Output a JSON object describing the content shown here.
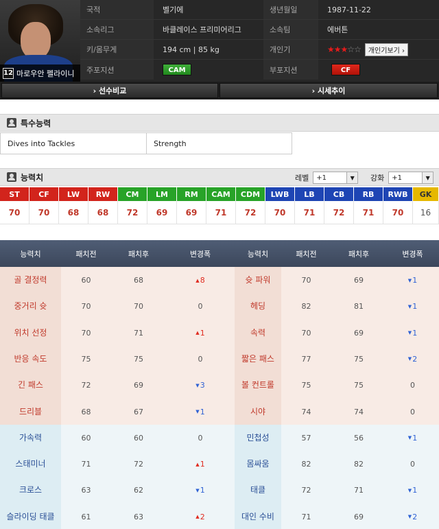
{
  "profile": {
    "number": "12",
    "name": "마로우안 펠라이니",
    "rows": [
      {
        "l1": "국적",
        "v1": "벨기에",
        "l2": "생년월일",
        "v2": "1987-11-22"
      },
      {
        "l1": "소속리그",
        "v1": "바클레이스 프리미어리그",
        "l2": "소속팀",
        "v2": "에버튼"
      },
      {
        "l1": "키/몸무게",
        "v1": "194 cm | 85 kg",
        "l2": "개인기",
        "v2": ""
      },
      {
        "l1": "주포지션",
        "v1": "",
        "l2": "부포지션",
        "v2": ""
      }
    ],
    "skill_stars": {
      "filled": 3,
      "total": 5
    },
    "skill_button": "개인기보기 ›",
    "main_position": "CAM",
    "sub_position": "CF"
  },
  "nav": {
    "compare": "› 선수비교",
    "price": "› 시세추이"
  },
  "special": {
    "title": "특수능력",
    "items": [
      "Dives into Tackles",
      "Strength"
    ]
  },
  "ability": {
    "title": "능력치",
    "level_label": "레벨",
    "level_value": "+1",
    "enhance_label": "강화",
    "enhance_value": "+1"
  },
  "colors": {
    "fw": "#d2241c",
    "mf": "#28a328",
    "df": "#1e45b4",
    "gk": "#e6b800"
  },
  "positions": [
    {
      "name": "ST",
      "value": "70",
      "group": "fw"
    },
    {
      "name": "CF",
      "value": "70",
      "group": "fw"
    },
    {
      "name": "LW",
      "value": "68",
      "group": "fw"
    },
    {
      "name": "RW",
      "value": "68",
      "group": "fw"
    },
    {
      "name": "CM",
      "value": "72",
      "group": "mf"
    },
    {
      "name": "LM",
      "value": "69",
      "group": "mf"
    },
    {
      "name": "RM",
      "value": "69",
      "group": "mf"
    },
    {
      "name": "CAM",
      "value": "71",
      "group": "mf"
    },
    {
      "name": "CDM",
      "value": "72",
      "group": "mf"
    },
    {
      "name": "LWB",
      "value": "70",
      "group": "df"
    },
    {
      "name": "LB",
      "value": "71",
      "group": "df"
    },
    {
      "name": "CB",
      "value": "72",
      "group": "df"
    },
    {
      "name": "RB",
      "value": "71",
      "group": "df"
    },
    {
      "name": "RWB",
      "value": "70",
      "group": "df"
    },
    {
      "name": "GK",
      "value": "16",
      "group": "gk"
    }
  ],
  "stats": {
    "headers": [
      "능력치",
      "패치전",
      "패치후",
      "변경폭",
      "능력치",
      "패치전",
      "패치후",
      "변경폭"
    ],
    "rows": [
      {
        "group": "a",
        "left": {
          "name": "골 결정력",
          "before": "60",
          "after": "68",
          "change": "8",
          "dir": "up"
        },
        "right": {
          "name": "슛 파워",
          "before": "70",
          "after": "69",
          "change": "1",
          "dir": "down"
        }
      },
      {
        "group": "a",
        "left": {
          "name": "중거리 슛",
          "before": "70",
          "after": "70",
          "change": "0",
          "dir": "none"
        },
        "right": {
          "name": "헤딩",
          "before": "82",
          "after": "81",
          "change": "1",
          "dir": "down"
        }
      },
      {
        "group": "a",
        "left": {
          "name": "위치 선정",
          "before": "70",
          "after": "71",
          "change": "1",
          "dir": "up"
        },
        "right": {
          "name": "속력",
          "before": "70",
          "after": "69",
          "change": "1",
          "dir": "down"
        }
      },
      {
        "group": "a",
        "left": {
          "name": "반응 속도",
          "before": "75",
          "after": "75",
          "change": "0",
          "dir": "none"
        },
        "right": {
          "name": "짧은 패스",
          "before": "77",
          "after": "75",
          "change": "2",
          "dir": "down"
        }
      },
      {
        "group": "a",
        "left": {
          "name": "긴 패스",
          "before": "72",
          "after": "69",
          "change": "3",
          "dir": "down"
        },
        "right": {
          "name": "볼 컨트롤",
          "before": "75",
          "after": "75",
          "change": "0",
          "dir": "none"
        }
      },
      {
        "group": "a",
        "left": {
          "name": "드리블",
          "before": "68",
          "after": "67",
          "change": "1",
          "dir": "down"
        },
        "right": {
          "name": "시야",
          "before": "74",
          "after": "74",
          "change": "0",
          "dir": "none"
        }
      },
      {
        "group": "b",
        "left": {
          "name": "가속력",
          "before": "60",
          "after": "60",
          "change": "0",
          "dir": "none"
        },
        "right": {
          "name": "민첩성",
          "before": "57",
          "after": "56",
          "change": "1",
          "dir": "down"
        }
      },
      {
        "group": "b",
        "left": {
          "name": "스태미너",
          "before": "71",
          "after": "72",
          "change": "1",
          "dir": "up"
        },
        "right": {
          "name": "몸싸움",
          "before": "82",
          "after": "82",
          "change": "0",
          "dir": "none"
        }
      },
      {
        "group": "b",
        "left": {
          "name": "크로스",
          "before": "63",
          "after": "62",
          "change": "1",
          "dir": "down"
        },
        "right": {
          "name": "태클",
          "before": "72",
          "after": "71",
          "change": "1",
          "dir": "down"
        }
      },
      {
        "group": "b",
        "left": {
          "name": "슬라이딩 태클",
          "before": "61",
          "after": "63",
          "change": "2",
          "dir": "up"
        },
        "right": {
          "name": "대인 수비",
          "before": "71",
          "after": "69",
          "change": "2",
          "dir": "down"
        }
      }
    ]
  }
}
